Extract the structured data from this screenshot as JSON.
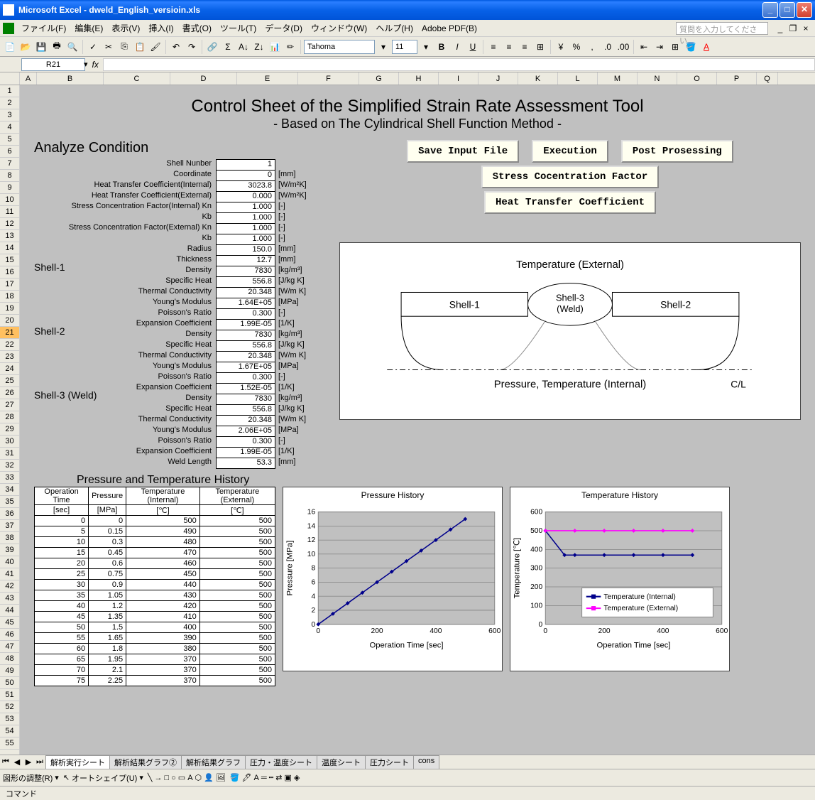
{
  "window": {
    "app_title": "Microsoft Excel - dweld_English_versioin.xls",
    "help_placeholder": "質問を入力してください"
  },
  "menu": {
    "file": "ファイル(F)",
    "edit": "編集(E)",
    "view": "表示(V)",
    "insert": "挿入(I)",
    "format": "書式(O)",
    "tool": "ツール(T)",
    "data": "データ(D)",
    "window": "ウィンドウ(W)",
    "help": "ヘルプ(H)",
    "adobe": "Adobe PDF(B)"
  },
  "toolbar": {
    "font_name": "Tahoma",
    "font_size": "11"
  },
  "name_box": "R21",
  "columns": [
    "A",
    "B",
    "C",
    "D",
    "E",
    "F",
    "G",
    "H",
    "I",
    "J",
    "K",
    "L",
    "M",
    "N",
    "O",
    "P",
    "Q"
  ],
  "rows_visible": [
    1,
    2,
    3,
    4,
    5,
    6,
    7,
    8,
    9,
    10,
    11,
    12,
    13,
    14,
    15,
    16,
    17,
    18,
    19,
    20,
    21,
    22,
    23,
    24,
    25,
    26,
    27,
    28,
    29,
    30,
    31,
    32,
    33,
    34,
    35,
    36,
    37,
    38,
    39,
    40,
    41,
    42,
    43,
    44,
    45,
    46,
    47,
    48,
    49,
    50,
    51,
    52,
    53,
    54,
    55
  ],
  "selected_row": 21,
  "sheet": {
    "title": "Control Sheet of the Simplified Strain Rate Assessment Tool",
    "subtitle": "- Based on The Cylindrical Shell Function Method -",
    "section1": "Analyze Condition",
    "shell1": "Shell-1",
    "shell2": "Shell-2",
    "shell3": "Shell-3 (Weld)"
  },
  "buttons": {
    "save": "Save Input File",
    "exec": "Execution",
    "post": "Post Prosessing",
    "scf": "Stress Cocentration Factor",
    "htc": "Heat Transfer Coefficient"
  },
  "params": [
    {
      "label": "Shell Nunber",
      "val": "1",
      "unit": ""
    },
    {
      "label": "Coordinate",
      "val": "0",
      "unit": "[mm]"
    },
    {
      "label": "Heat Transfer Coefficient(Internal)",
      "val": "3023.8",
      "unit": "[W/m²K]"
    },
    {
      "label": "Heat Transfer Coefficient(External)",
      "val": "0.000",
      "unit": "[W/m²K]"
    },
    {
      "label": "Stress Concentration Factor(Internal)  Kn",
      "val": "1.000",
      "unit": "[-]"
    },
    {
      "label": "Kb",
      "val": "1.000",
      "unit": "[-]"
    },
    {
      "label": "Stress Concentration Factor(External)  Kn",
      "val": "1.000",
      "unit": "[-]"
    },
    {
      "label": "Kb",
      "val": "1.000",
      "unit": "[-]"
    },
    {
      "label": "Radius",
      "val": "150.0",
      "unit": "[mm]"
    },
    {
      "label": "Thickness",
      "val": "12.7",
      "unit": "[mm]"
    },
    {
      "label": "Density",
      "val": "7830",
      "unit": "[kg/m³]"
    },
    {
      "label": "Specific Heat",
      "val": "556.8",
      "unit": "[J/kg K]"
    },
    {
      "label": "Thermal Conductivity",
      "val": "20.348",
      "unit": "[W/m K]"
    },
    {
      "label": "Young's Modulus",
      "val": "1.64E+05",
      "unit": "[MPa]"
    },
    {
      "label": "Poisson's Ratio",
      "val": "0.300",
      "unit": "[-]"
    },
    {
      "label": "Expansion Coefficient",
      "val": "1.99E-05",
      "unit": "[1/K]"
    },
    {
      "label": "Density",
      "val": "7830",
      "unit": "[kg/m³]"
    },
    {
      "label": "Specific Heat",
      "val": "556.8",
      "unit": "[J/kg K]"
    },
    {
      "label": "Thermal Conductivity",
      "val": "20.348",
      "unit": "[W/m K]"
    },
    {
      "label": "Young's Modulus",
      "val": "1.67E+05",
      "unit": "[MPa]"
    },
    {
      "label": "Poisson's Ratio",
      "val": "0.300",
      "unit": "[-]"
    },
    {
      "label": "Expansion Coefficient",
      "val": "1.52E-05",
      "unit": "[1/K]"
    },
    {
      "label": "Density",
      "val": "7830",
      "unit": "[kg/m³]"
    },
    {
      "label": "Specific Heat",
      "val": "556.8",
      "unit": "[J/kg K]"
    },
    {
      "label": "Thermal Conductivity",
      "val": "20.348",
      "unit": "[W/m K]"
    },
    {
      "label": "Young's Modulus",
      "val": "2.06E+05",
      "unit": "[MPa]"
    },
    {
      "label": "Poisson's Ratio",
      "val": "0.300",
      "unit": "[-]"
    },
    {
      "label": "Expansion Coefficient",
      "val": "1.99E-05",
      "unit": "[1/K]"
    },
    {
      "label": "Weld Length",
      "val": "53.3",
      "unit": "[mm]"
    }
  ],
  "diagram": {
    "temp_ext": "Temperature (External)",
    "s1": "Shell-1",
    "s3a": "Shell-3",
    "s3b": "(Weld)",
    "s2": "Shell-2",
    "press_int": "Pressure, Temperature (Internal)",
    "cl": "C/L"
  },
  "history": {
    "title": "Pressure and Temperature History",
    "h_time": "Operation Time",
    "h_press": "Pressure",
    "h_ti": "Temperature (Internal)",
    "h_te": "Temperature (External)",
    "u_time": "[sec]",
    "u_press": "[MPa]",
    "u_temp": "[℃]",
    "rows": [
      {
        "t": "0",
        "p": "0",
        "ti": "500",
        "te": "500"
      },
      {
        "t": "5",
        "p": "0.15",
        "ti": "490",
        "te": "500"
      },
      {
        "t": "10",
        "p": "0.3",
        "ti": "480",
        "te": "500"
      },
      {
        "t": "15",
        "p": "0.45",
        "ti": "470",
        "te": "500"
      },
      {
        "t": "20",
        "p": "0.6",
        "ti": "460",
        "te": "500"
      },
      {
        "t": "25",
        "p": "0.75",
        "ti": "450",
        "te": "500"
      },
      {
        "t": "30",
        "p": "0.9",
        "ti": "440",
        "te": "500"
      },
      {
        "t": "35",
        "p": "1.05",
        "ti": "430",
        "te": "500"
      },
      {
        "t": "40",
        "p": "1.2",
        "ti": "420",
        "te": "500"
      },
      {
        "t": "45",
        "p": "1.35",
        "ti": "410",
        "te": "500"
      },
      {
        "t": "50",
        "p": "1.5",
        "ti": "400",
        "te": "500"
      },
      {
        "t": "55",
        "p": "1.65",
        "ti": "390",
        "te": "500"
      },
      {
        "t": "60",
        "p": "1.8",
        "ti": "380",
        "te": "500"
      },
      {
        "t": "65",
        "p": "1.95",
        "ti": "370",
        "te": "500"
      },
      {
        "t": "70",
        "p": "2.1",
        "ti": "370",
        "te": "500"
      },
      {
        "t": "75",
        "p": "2.25",
        "ti": "370",
        "te": "500"
      }
    ]
  },
  "chart_data": [
    {
      "type": "scatter-line",
      "title": "Pressure History",
      "xlabel": "Operation Time [sec]",
      "ylabel": "Pressure [MPa]",
      "xlim": [
        0,
        600
      ],
      "ylim": [
        0,
        16
      ],
      "xticks": [
        0,
        200,
        400,
        600
      ],
      "yticks": [
        0,
        2,
        4,
        6,
        8,
        10,
        12,
        14,
        16
      ],
      "series": [
        {
          "name": "Pressure",
          "color": "#00008b",
          "x": [
            0,
            50,
            100,
            150,
            200,
            250,
            300,
            350,
            400,
            450,
            500
          ],
          "y": [
            0,
            1.5,
            3,
            4.5,
            6,
            7.5,
            9,
            10.5,
            12,
            13.5,
            15
          ]
        }
      ]
    },
    {
      "type": "scatter-line",
      "title": "Temperature History",
      "xlabel": "Operation Time [sec]",
      "ylabel": "Temperature [℃]",
      "xlim": [
        0,
        600
      ],
      "ylim": [
        0,
        600
      ],
      "xticks": [
        0,
        200,
        400,
        600
      ],
      "yticks": [
        0,
        100,
        200,
        300,
        400,
        500,
        600
      ],
      "series": [
        {
          "name": "Temperature (Internal)",
          "color": "#00008b",
          "x": [
            0,
            65,
            100,
            200,
            300,
            400,
            500
          ],
          "y": [
            500,
            370,
            370,
            370,
            370,
            370,
            370
          ]
        },
        {
          "name": "Temperature (External)",
          "color": "#ff00ff",
          "x": [
            0,
            100,
            200,
            300,
            400,
            500
          ],
          "y": [
            500,
            500,
            500,
            500,
            500,
            500
          ]
        }
      ],
      "legend": [
        "Temperature (Internal)",
        "Temperature (External)"
      ]
    }
  ],
  "tabs": [
    "解析実行シート",
    "解析結果グラフ②",
    "解析結果グラフ",
    "圧力・温度シート",
    "温度シート",
    "圧力シート",
    "cons"
  ],
  "draw_toolbar": {
    "label": "図形の調整(R)",
    "autoshape": "オートシェイプ(U)"
  },
  "status": "コマンド"
}
